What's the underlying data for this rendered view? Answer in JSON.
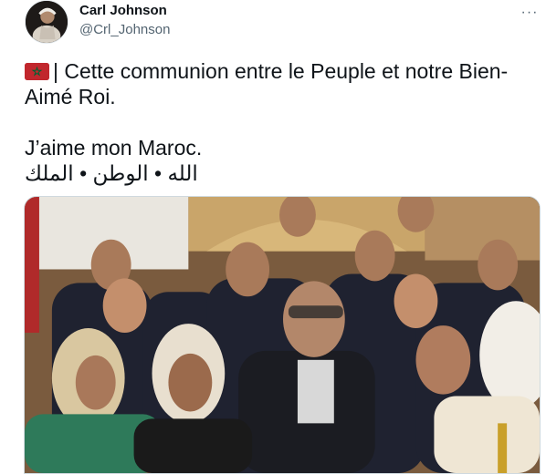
{
  "author": {
    "display_name": "Carl Johnson",
    "handle": "@Crl_Johnson",
    "avatar_icon": "profile-avatar"
  },
  "more_menu": {
    "label": "···",
    "icon": "more-horizontal-icon"
  },
  "tweet": {
    "flag_icon": "morocco-flag-icon",
    "line1_text": "| Cette communion entre le Peuple et notre Bien-",
    "line2_text": "Aimé Roi.",
    "line3_text": "J’aime mon Maroc.",
    "line4_text": "الله • الوطن • الملك"
  },
  "media": {
    "kind": "photo"
  },
  "colors": {
    "text_primary": "#0f1419",
    "text_secondary": "#536471",
    "border": "#cfd9de",
    "flag_red": "#c1272d",
    "flag_green": "#006233"
  }
}
